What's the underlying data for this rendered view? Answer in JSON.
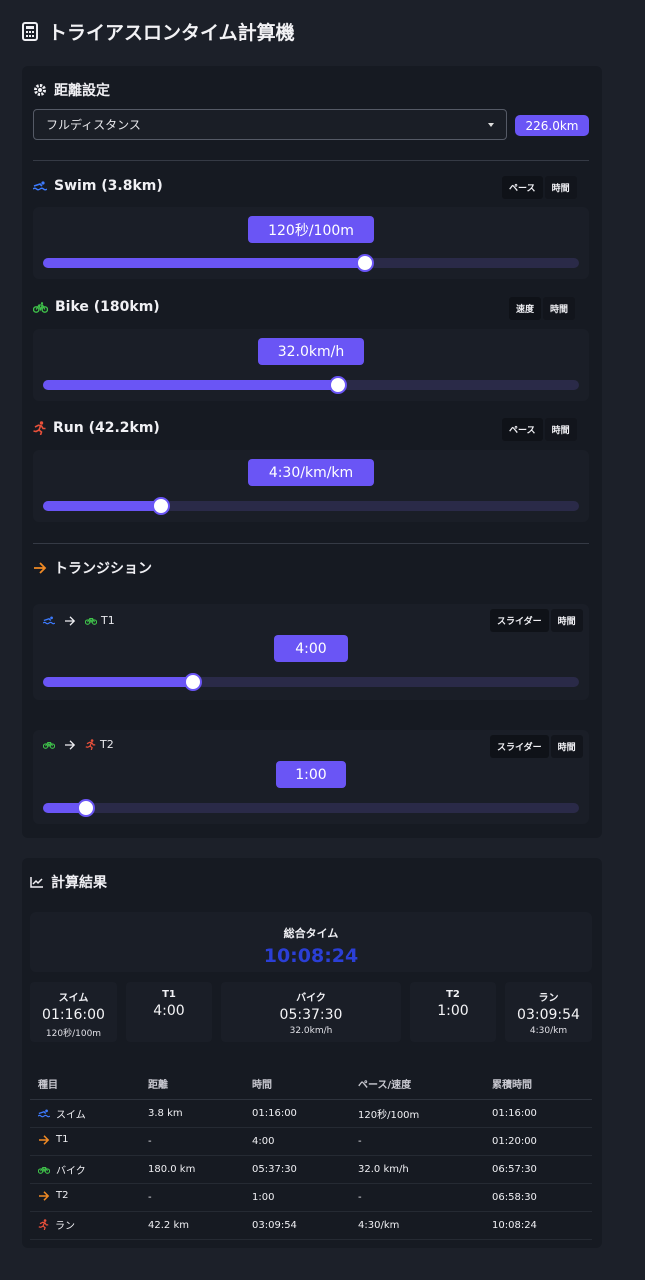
{
  "page": {
    "title": "トライアスロンタイム計算機"
  },
  "distance": {
    "title": "距離設定",
    "selected": "フルディスタンス",
    "total": "226.0km"
  },
  "swim": {
    "title": "Swim (3.8km)",
    "btn1": "ペース",
    "btn2": "時間",
    "value": "120秒/100m",
    "level": 0.6
  },
  "bike": {
    "title": "Bike (180km)",
    "btn1": "速度",
    "btn2": "時間",
    "value": "32.0km/h",
    "level": 0.55
  },
  "run": {
    "title": "Run (42.2km)",
    "btn1": "ペース",
    "btn2": "時間",
    "value": "4:30/km/km",
    "level": 0.22
  },
  "transition": {
    "title": "トランジション",
    "t1": {
      "label": "T1",
      "btn1": "スライダー",
      "btn2": "時間",
      "value": "4:00",
      "level": 0.28
    },
    "t2": {
      "label": "T2",
      "btn1": "スライダー",
      "btn2": "時間",
      "value": "1:00",
      "level": 0.08
    }
  },
  "results": {
    "title": "計算結果",
    "total_label": "総合タイム",
    "total_value": "10:08:24",
    "tiles": [
      {
        "label": "スイム",
        "time": "01:16:00",
        "sub": "120秒/100m"
      },
      {
        "label": "T1",
        "time": "4:00",
        "sub": ""
      },
      {
        "label": "バイク",
        "time": "05:37:30",
        "sub": "32.0km/h"
      },
      {
        "label": "T2",
        "time": "1:00",
        "sub": ""
      },
      {
        "label": "ラン",
        "time": "03:09:54",
        "sub": "4:30/km"
      }
    ],
    "headers": [
      "種目",
      "距離",
      "時間",
      "ペース/速度",
      "累積時間"
    ],
    "rows": [
      {
        "icon": "swim-icon",
        "name": "スイム",
        "dist": "3.8 km",
        "time": "01:16:00",
        "pace": "120秒/100m",
        "cum": "01:16:00"
      },
      {
        "icon": "arrow-right-icon",
        "name": "T1",
        "dist": "-",
        "time": "4:00",
        "pace": "-",
        "cum": "01:20:00"
      },
      {
        "icon": "bike-icon",
        "name": "バイク",
        "dist": "180.0 km",
        "time": "05:37:30",
        "pace": "32.0 km/h",
        "cum": "06:57:30"
      },
      {
        "icon": "arrow-right-icon",
        "name": "T2",
        "dist": "-",
        "time": "1:00",
        "pace": "-",
        "cum": "06:58:30"
      },
      {
        "icon": "run-icon",
        "name": "ラン",
        "dist": "42.2 km",
        "time": "03:09:54",
        "pace": "4:30/km",
        "cum": "10:08:24"
      }
    ]
  },
  "colors": {
    "accent": "#6a55f5",
    "swim": "#3d7bff",
    "bike": "#3fc24a",
    "run": "#e8503a",
    "transition": "#f08a24",
    "total": "#2b3fd6"
  }
}
